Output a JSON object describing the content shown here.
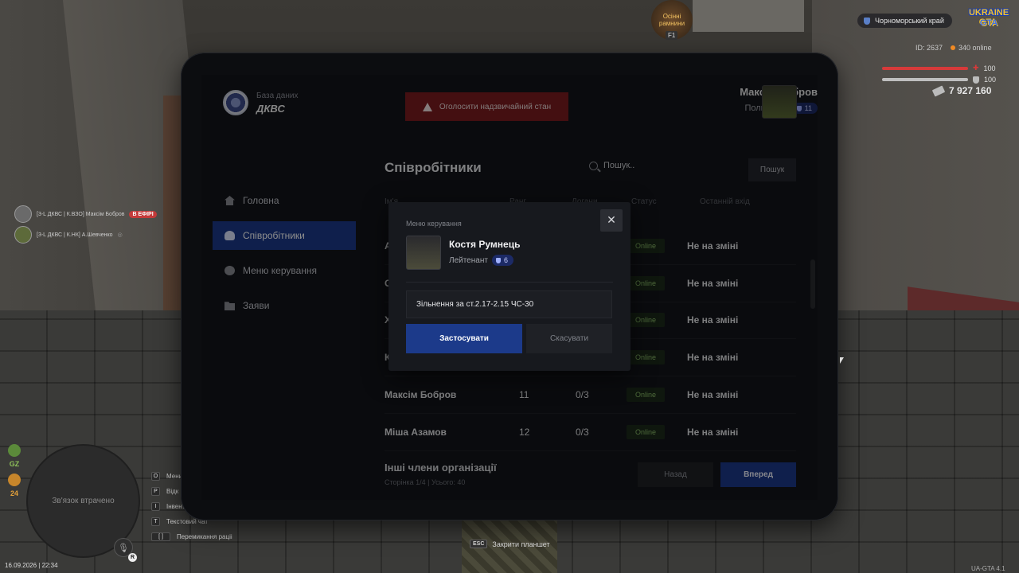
{
  "hud": {
    "region": "Чорноморський край",
    "logo_line1": "UKRAINE",
    "logo_line2": "GTA",
    "event_badge": "Осінні рамнини",
    "event_key": "F1",
    "id_label": "ID: 2637",
    "online_label": "340 online",
    "health_value": "100",
    "health_percent": 100,
    "armor_value": "100",
    "armor_percent": 100,
    "money": "7 927 160",
    "health_color": "#d63a3a",
    "armor_color": "#bfbfbf"
  },
  "voice": [
    {
      "text": "[3-L ДКВС | К.ВЗО] Максім Бобров",
      "tag": "В ЕФІРІ"
    },
    {
      "text": "[3-L ДКВС | К.НК] А.Шевченко",
      "tag": ""
    }
  ],
  "minimap": {
    "status": "Зв'язок втрачено",
    "gz_label": "GZ",
    "level_label": "24",
    "date": "16.09.2026 | 22:34",
    "mic_key": "R"
  },
  "hotkeys": [
    {
      "key": "O",
      "label": "Мени"
    },
    {
      "key": "P",
      "label": "Відк"
    },
    {
      "key": "I",
      "label": "Інвент"
    },
    {
      "key": "T",
      "label": "Текстовий чат"
    },
    {
      "key": "[ ]",
      "label": "Перемикання раціі"
    }
  ],
  "esc_hint": {
    "key": "ESC",
    "label": "Закрити планшет"
  },
  "version": "UA-GTA 4.1",
  "tablet": {
    "brand_sub": "База даних",
    "brand_title": "ДКВС",
    "alarm_label": "Оголосити надзвичайний стан",
    "user": {
      "name": "Максім Бобров",
      "rank": "Полковник",
      "level": "11"
    },
    "nav": [
      {
        "label": "Головна",
        "icon": "home-icon",
        "active": false
      },
      {
        "label": "Співробітники",
        "icon": "users-icon",
        "active": true
      },
      {
        "label": "Меню керування",
        "icon": "gear-icon",
        "active": false
      },
      {
        "label": "Заяви",
        "icon": "folder-icon",
        "active": false
      }
    ],
    "section_title": "Співробітники",
    "search_placeholder": "Пошук..",
    "search_button": "Пошук",
    "headers": {
      "name": "Ім'я",
      "level": "Ранг",
      "warns": "Догани",
      "status": "Статус",
      "last_login": "Останній вхід"
    },
    "rows": [
      {
        "name": "А",
        "level": "",
        "warns": "",
        "status": "Online",
        "shift": "Не на зміні"
      },
      {
        "name": "С",
        "level": "",
        "warns": "",
        "status": "Online",
        "shift": "Не на зміні"
      },
      {
        "name": "Х",
        "level": "",
        "warns": "",
        "status": "Online",
        "shift": "Не на зміні"
      },
      {
        "name": "К",
        "level": "",
        "warns": "",
        "status": "Online",
        "shift": "Не на зміні"
      },
      {
        "name": "Максім Бобров",
        "level": "11",
        "warns": "0/3",
        "status": "Online",
        "shift": "Не на зміні"
      },
      {
        "name": "Міша Азамов",
        "level": "12",
        "warns": "0/3",
        "status": "Online",
        "shift": "Не на зміні"
      }
    ],
    "others_title": "Інші члени організації",
    "page_info": "Сторінка 1/4 | Усього: 40",
    "back_label": "Назад",
    "next_label": "Вперед",
    "accent": "#1c3a8a"
  },
  "modal": {
    "title": "Меню керування",
    "name": "Костя Румнець",
    "rank": "Лейтенант",
    "level": "6",
    "reason_value": "Зільнення за ст.2.17-2.15 ЧС-30",
    "apply_label": "Застосувати",
    "cancel_label": "Скасувати",
    "close_glyph": "✕"
  }
}
